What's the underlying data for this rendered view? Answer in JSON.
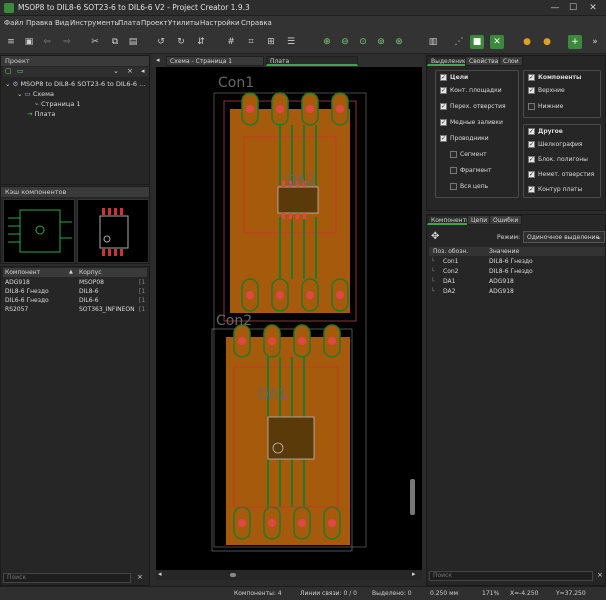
{
  "window": {
    "title": "MSOP8 to DIL8-6 SOT23-6 to DIL6-6 V2 - Project Creator 1.9.3",
    "buttons": [
      "—",
      "☐",
      "✕"
    ]
  },
  "menu": [
    "Файл",
    "Правка",
    "Вид",
    "Инструменты",
    "Плата",
    "Проект",
    "Утилиты",
    "Настройки",
    "Справка"
  ],
  "project_panel": {
    "header": "Проект",
    "root": "MSOP8 to DIL8-6 SOT23-6 to DIL6-6 ...",
    "schema": "Схема",
    "page": "Страница 1",
    "board": "Плата"
  },
  "component_cache": {
    "header": "Кэш компонентов"
  },
  "component_table": {
    "col_component": "Компонент",
    "col_package": "Корпус",
    "rows": [
      {
        "component": "ADG918",
        "package": "MSOP08",
        "flag": "[1"
      },
      {
        "component": "DIL8-6 Гнездо",
        "package": "DIL8-6",
        "flag": "[1"
      },
      {
        "component": "DIL6-6 Гнездо",
        "package": "DIL6-6",
        "flag": "[1"
      },
      {
        "component": "RS2057",
        "package": "SOT363_INFINEON",
        "flag": "[1"
      }
    ],
    "search_placeholder": "Поиск"
  },
  "doc_tabs": {
    "schema_tab": "Схема - Страница 1",
    "board_tab": "Плата"
  },
  "pcb": {
    "labels": [
      "Con1",
      "DA2",
      "Con2",
      "DA1"
    ]
  },
  "right_tabs": {
    "tab1": "Выделение",
    "tab2": "Свойства",
    "tab3": "Слои"
  },
  "selection_filter": {
    "targets": {
      "title": "Цели",
      "items": [
        {
          "label": "Конт. площадки",
          "checked": true
        },
        {
          "label": "Перех. отверстия",
          "checked": true
        },
        {
          "label": "Медные заливки",
          "checked": true
        },
        {
          "label": "Проводники",
          "checked": true
        },
        {
          "label": "Сегмент",
          "checked": false
        },
        {
          "label": "Фрагмент",
          "checked": false
        },
        {
          "label": "Вся цепь",
          "checked": false
        }
      ]
    },
    "components": {
      "title": "Компоненты",
      "items": [
        {
          "label": "Верхние",
          "checked": true
        },
        {
          "label": "Нижние",
          "checked": false
        }
      ]
    },
    "other": {
      "title": "Другое",
      "items": [
        {
          "label": "Шелкография",
          "checked": true
        },
        {
          "label": "Блок. полигоны",
          "checked": true
        },
        {
          "label": "Немет. отверстия",
          "checked": true
        },
        {
          "label": "Контур платы",
          "checked": true
        }
      ]
    }
  },
  "bottom_tabs": {
    "tab1": "Компоненты",
    "tab2": "Цепи",
    "tab3": "Ошибки"
  },
  "mode": {
    "label": "Режим:",
    "value": "Одиночное выделение"
  },
  "ref_table": {
    "col_ref": "Поз. обозн.",
    "col_value": "Значение",
    "rows": [
      {
        "ref": "Con1",
        "value": "DIL8-6 Гнездо"
      },
      {
        "ref": "Con2",
        "value": "DIL8-6 Гнездо"
      },
      {
        "ref": "DA1",
        "value": "ADG918"
      },
      {
        "ref": "DA2",
        "value": "ADG918"
      }
    ],
    "search_placeholder": "Поиск"
  },
  "status": {
    "components": "Компоненты: 4",
    "ratsnest": "Линии связи: 0 / 0",
    "selected": "Выделено: 0",
    "grid": "0.250 мм",
    "zoom": "171%",
    "x": "X=-4.250",
    "y": "Y=37.250"
  },
  "colors": {
    "copper": "#b8640a",
    "silk_outline": "#d03030",
    "mask": "#1f7a2a",
    "accent": "#3da64a"
  }
}
